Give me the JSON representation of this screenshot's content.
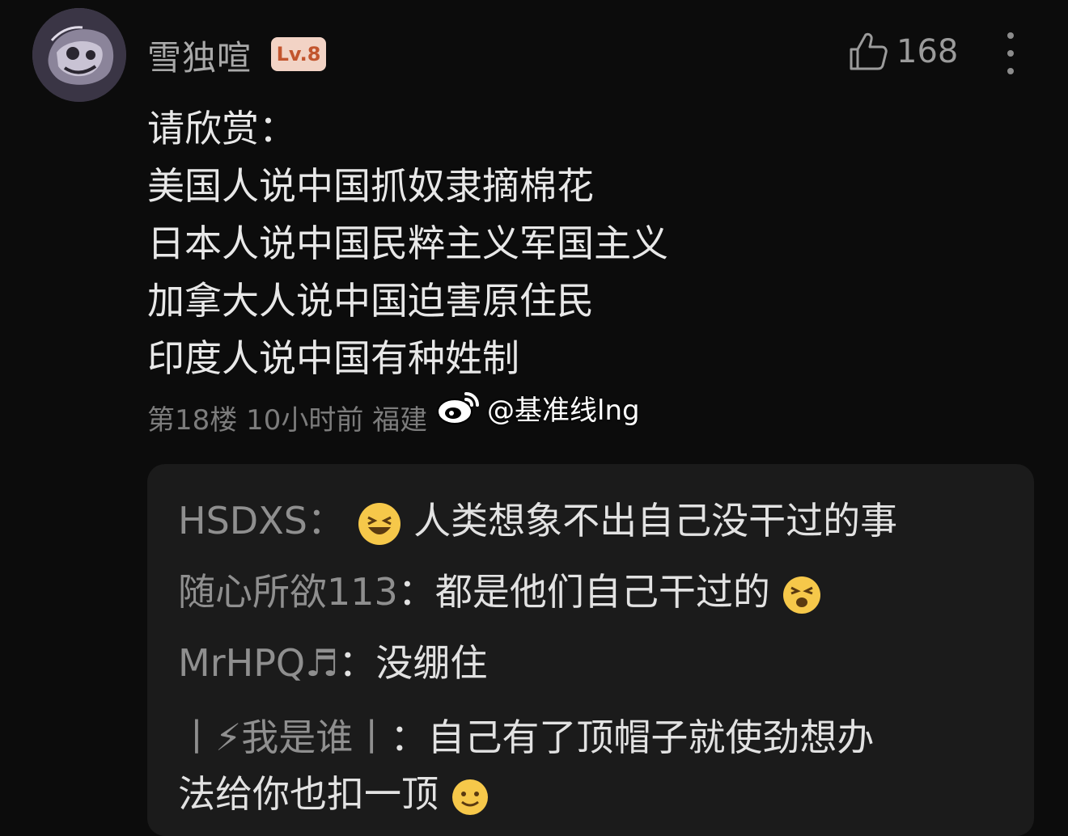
{
  "post": {
    "username": "雪独喧",
    "level": "Lv.8",
    "like_count": "168",
    "content_lines": [
      "请欣赏：",
      "美国人说中国抓奴隶摘棉花",
      "日本人说中国民粹主义军国主义",
      "加拿大人说中国迫害原住民",
      "印度人说中国有种姓制"
    ],
    "meta": "第18楼 10小时前 福建"
  },
  "watermark": {
    "text": "@基准线lng",
    "icon": "weibo-icon"
  },
  "replies": [
    {
      "name": "HSDXS",
      "sep": "：",
      "text": "人类想象不出自己没干过的事",
      "emoji": "laughing-emoji"
    },
    {
      "name": "随心所欲113",
      "sep": "：",
      "text": "都是他们自己干过的",
      "emoji": "squinting-emoji"
    },
    {
      "name": "MrHPQ♬",
      "sep": "：",
      "text": "没绷住"
    },
    {
      "name": "丨⚡我是谁丨",
      "sep": "：",
      "text": "自己有了顶帽子就使劲想办",
      "text2": "法给你也扣一顶",
      "emoji": "smile-emoji"
    }
  ],
  "colors": {
    "level_bg": "#f2d3c5",
    "level_text": "#c2552e",
    "reply_bg": "#1b1b1b",
    "background": "#0c0c0c"
  }
}
